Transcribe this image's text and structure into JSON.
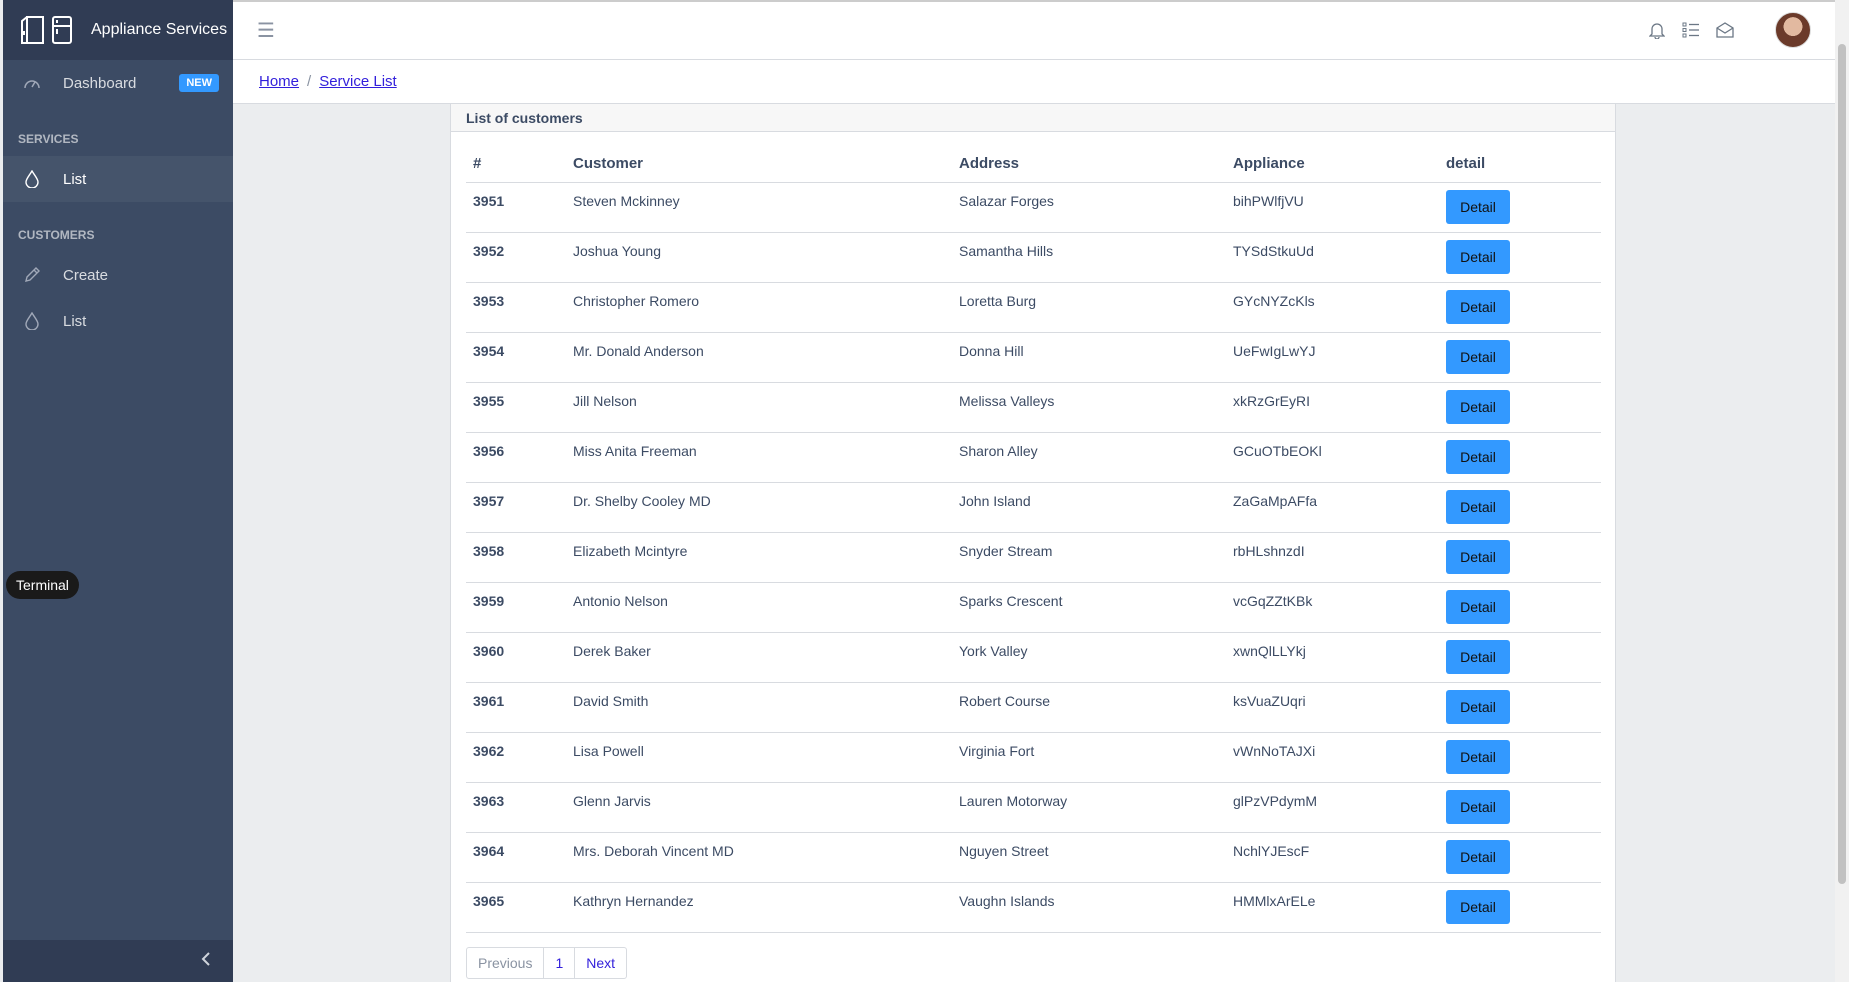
{
  "sidebar": {
    "brand_title": "Appliance Services",
    "dashboard_label": "Dashboard",
    "dashboard_badge": "NEW",
    "services_title": "SERVICES",
    "services_list_label": "List",
    "customers_title": "CUSTOMERS",
    "customers_create_label": "Create",
    "customers_list_label": "List"
  },
  "tooltip": "Terminal",
  "header": {
    "hamburger": "☰"
  },
  "breadcrumb": {
    "home": "Home",
    "sep": "/",
    "current": "Service List"
  },
  "card": {
    "title": "List of customers",
    "columns": [
      "#",
      "Customer",
      "Address",
      "Appliance",
      "detail"
    ],
    "button_label": "Detail",
    "rows": [
      {
        "id": "3951",
        "customer": "Steven Mckinney",
        "address": "Salazar Forges",
        "appliance": "bihPWlfjVU"
      },
      {
        "id": "3952",
        "customer": "Joshua Young",
        "address": "Samantha Hills",
        "appliance": "TYSdStkuUd"
      },
      {
        "id": "3953",
        "customer": "Christopher Romero",
        "address": "Loretta Burg",
        "appliance": "GYcNYZcKls"
      },
      {
        "id": "3954",
        "customer": "Mr. Donald Anderson",
        "address": "Donna Hill",
        "appliance": "UeFwIgLwYJ"
      },
      {
        "id": "3955",
        "customer": "Jill Nelson",
        "address": "Melissa Valleys",
        "appliance": "xkRzGrEyRI"
      },
      {
        "id": "3956",
        "customer": "Miss Anita Freeman",
        "address": "Sharon Alley",
        "appliance": "GCuOTbEOKl"
      },
      {
        "id": "3957",
        "customer": "Dr. Shelby Cooley MD",
        "address": "John Island",
        "appliance": "ZaGaMpAFfa"
      },
      {
        "id": "3958",
        "customer": "Elizabeth Mcintyre",
        "address": "Snyder Stream",
        "appliance": "rbHLshnzdI"
      },
      {
        "id": "3959",
        "customer": "Antonio Nelson",
        "address": "Sparks Crescent",
        "appliance": "vcGqZZtKBk"
      },
      {
        "id": "3960",
        "customer": "Derek Baker",
        "address": "York Valley",
        "appliance": "xwnQlLLYkj"
      },
      {
        "id": "3961",
        "customer": "David Smith",
        "address": "Robert Course",
        "appliance": "ksVuaZUqri"
      },
      {
        "id": "3962",
        "customer": "Lisa Powell",
        "address": "Virginia Fort",
        "appliance": "vWnNoTAJXi"
      },
      {
        "id": "3963",
        "customer": "Glenn Jarvis",
        "address": "Lauren Motorway",
        "appliance": "glPzVPdymM"
      },
      {
        "id": "3964",
        "customer": "Mrs. Deborah Vincent MD",
        "address": "Nguyen Street",
        "appliance": "NchlYJEscF"
      },
      {
        "id": "3965",
        "customer": "Kathryn Hernandez",
        "address": "Vaughn Islands",
        "appliance": "HMMlxArELe"
      }
    ]
  },
  "pagination": {
    "previous": "Previous",
    "page": "1",
    "next": "Next"
  },
  "colors": {
    "sidebar_bg": "#3c4b64",
    "accent": "#3399ff",
    "link": "#321fdb"
  }
}
